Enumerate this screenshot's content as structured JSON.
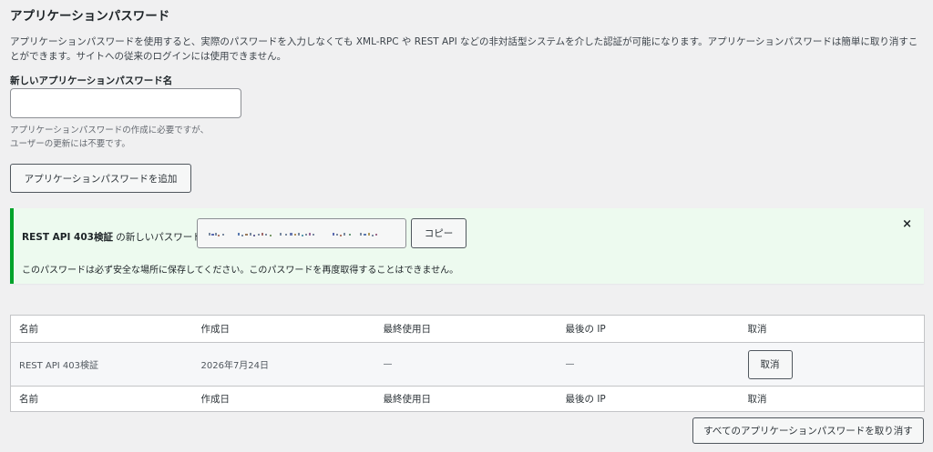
{
  "section": {
    "title": "アプリケーションパスワード",
    "description": "アプリケーションパスワードを使用すると、実際のパスワードを入力しなくても XML-RPC や REST API などの非対話型システムを介した認証が可能になります。アプリケーションパスワードは簡単に取り消すことができます。サイトへの従来のログインには使用できません。"
  },
  "new_password_form": {
    "label": "新しいアプリケーションパスワード名",
    "input_value": "",
    "help_line1": "アプリケーションパスワードの作成に必要ですが、",
    "help_line2": "ユーザーの更新には不要です。",
    "add_button": "アプリケーションパスワードを追加"
  },
  "notice": {
    "app_name": "REST API 403検証",
    "label_suffix": " の新しいパスワード:",
    "copy_button": "コピー",
    "dismiss": "×",
    "warning": "このパスワードは必ず安全な場所に保存してください。このパスワードを再度取得することはできません。"
  },
  "table": {
    "columns": [
      "名前",
      "作成日",
      "最終使用日",
      "最後の IP",
      "取消"
    ],
    "rows": [
      {
        "name": "REST API 403検証",
        "created": "2026年7月24日",
        "last_used": "—",
        "last_ip": "—",
        "revoke_button": "取消"
      }
    ]
  },
  "revoke_all_button": "すべてのアプリケーションパスワードを取り消す",
  "colors": {
    "page_bg": "#f0f0f1",
    "notice_bg": "#edfaef",
    "notice_border": "#00a32a",
    "button_border": "#50575e"
  },
  "icons": {
    "dismiss": "close-icon",
    "password_value": "blurred-password-pixels"
  }
}
